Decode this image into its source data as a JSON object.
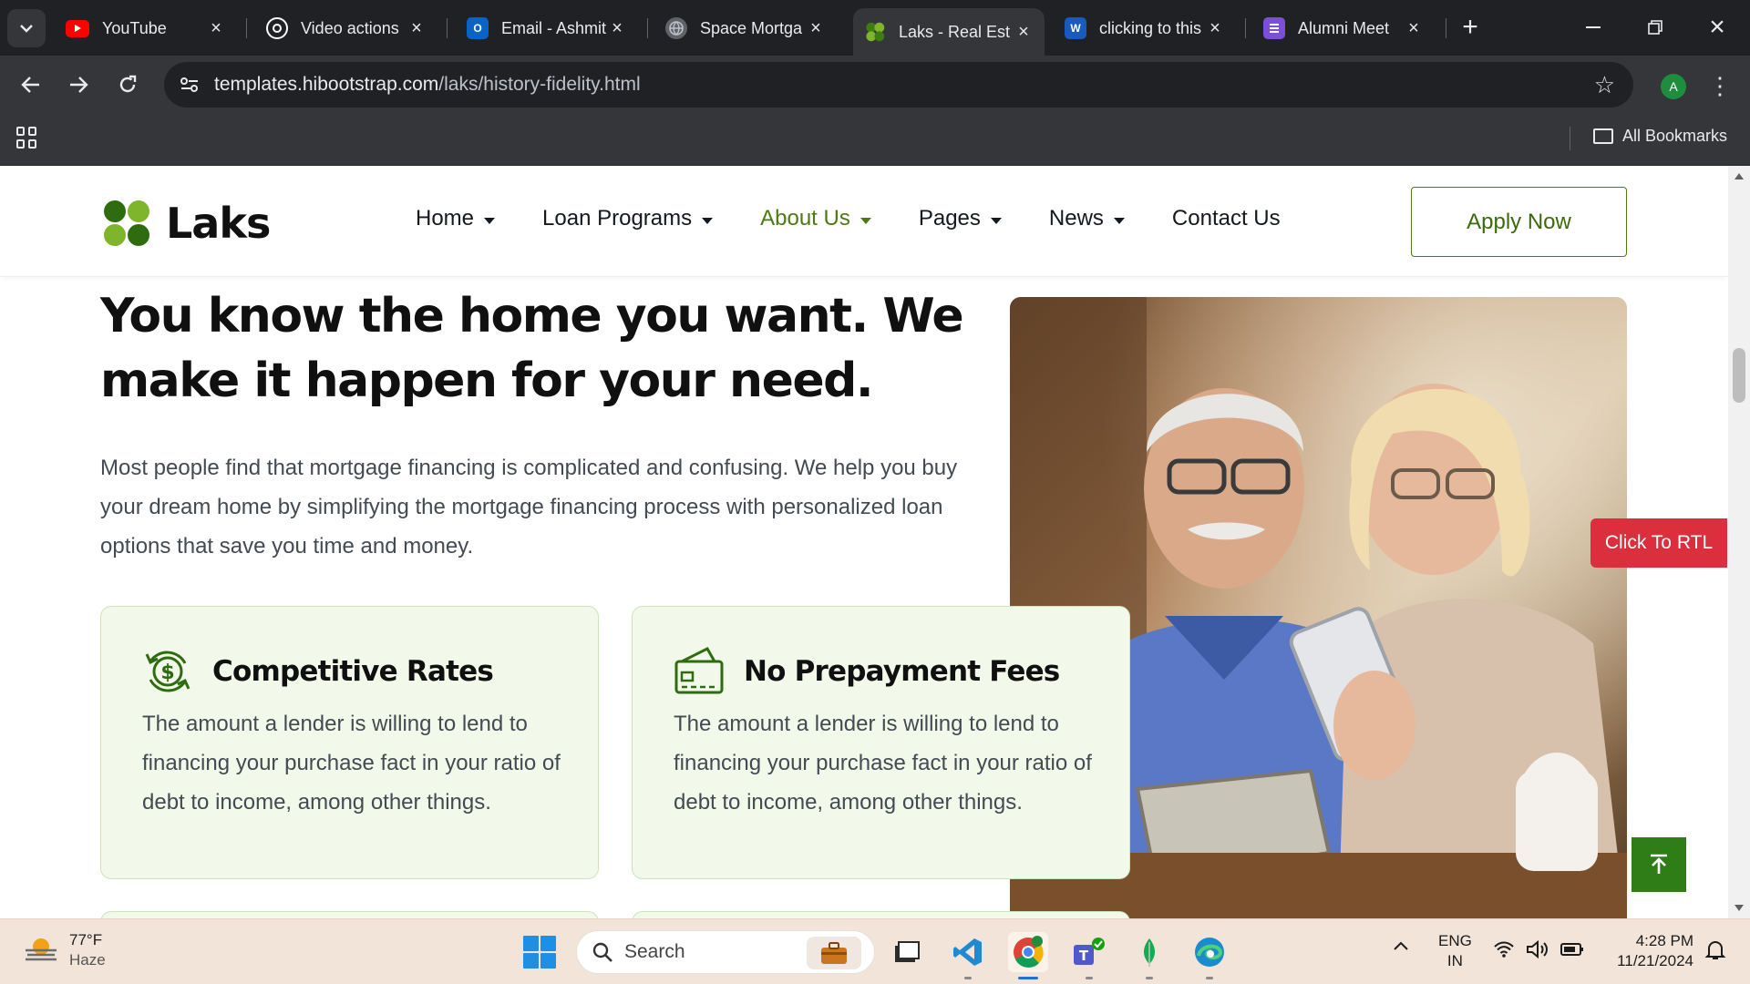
{
  "browser": {
    "tabs": [
      {
        "title": "YouTube",
        "icon": "youtube-icon",
        "color": "#ff0000"
      },
      {
        "title": "Video actions",
        "icon": "openai-icon",
        "color": "#ffffff"
      },
      {
        "title": "Email - Ashmit",
        "icon": "outlook-icon",
        "color": "#0a64c5"
      },
      {
        "title": "Space Mortga",
        "icon": "globe-icon",
        "color": "#9aa0a6"
      },
      {
        "title": "Laks - Real Est",
        "icon": "laks-icon",
        "color": "#4b8b1e",
        "active": true
      },
      {
        "title": "clicking to this",
        "icon": "word-icon",
        "color": "#185abd"
      },
      {
        "title": "Alumni Meet",
        "icon": "forms-icon",
        "color": "#7b4fd6"
      }
    ],
    "url_host": "templates.hibootstrap.com",
    "url_path": "/laks/history-fidelity.html",
    "profile_initial": "A",
    "all_bookmarks_label": "All Bookmarks"
  },
  "site": {
    "brand": "Laks",
    "nav": [
      {
        "label": "Home",
        "dropdown": true
      },
      {
        "label": "Loan Programs",
        "dropdown": true
      },
      {
        "label": "About Us",
        "dropdown": true,
        "active": true
      },
      {
        "label": "Pages",
        "dropdown": true
      },
      {
        "label": "News",
        "dropdown": true
      },
      {
        "label": "Contact Us",
        "dropdown": false
      }
    ],
    "apply_label": "Apply Now",
    "accent_color": "#4b7a13"
  },
  "hero": {
    "title": "You know the home you want. We make it happen for your need.",
    "text": "Most people find that mortgage financing is complicated and confusing. We help you buy your dream home by simplifying the mortgage financing process with personalized loan options that save you time and money."
  },
  "features": [
    {
      "title": "Competitive Rates",
      "icon": "dollar-cycle-icon",
      "text": "The amount a lender is willing to lend to financing your purchase fact in your ratio of debt to income, among other things."
    },
    {
      "title": "No Prepayment Fees",
      "icon": "credit-card-icon",
      "text": "The amount a lender is willing to lend to financing your purchase fact in your ratio of debt to income, among other things."
    }
  ],
  "floating": {
    "rtl_label": "Click To RTL"
  },
  "taskbar": {
    "weather_temp": "77°F",
    "weather_desc": "Haze",
    "search_label": "Search",
    "lang_line1": "ENG",
    "lang_line2": "IN",
    "time": "4:28 PM",
    "date": "11/21/2024"
  }
}
